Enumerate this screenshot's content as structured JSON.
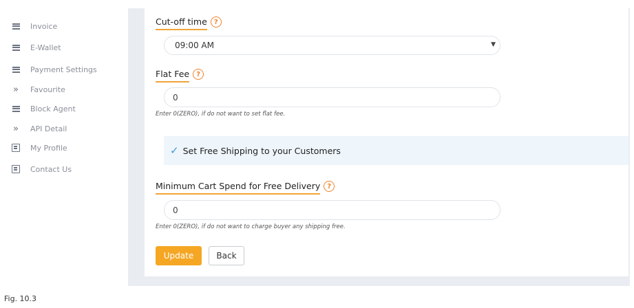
{
  "sidebar": {
    "items": [
      {
        "label": "Invoice",
        "icon": "list-icon"
      },
      {
        "label": "E-Wallet",
        "icon": "list-icon"
      },
      {
        "label": "Payment Settings",
        "icon": "list-icon"
      },
      {
        "label": "Favourite",
        "icon": "double-chevron-icon"
      },
      {
        "label": "Block Agent",
        "icon": "list-icon"
      },
      {
        "label": "API Detail",
        "icon": "double-chevron-icon"
      },
      {
        "label": "My Profile",
        "icon": "form-icon"
      },
      {
        "label": "Contact Us",
        "icon": "form-icon"
      }
    ]
  },
  "form": {
    "cutoff": {
      "label": "Cut-off time",
      "help": "?",
      "value": "09:00 AM"
    },
    "flat_fee": {
      "label": "Flat Fee",
      "help": "?",
      "value": "0",
      "hint": "Enter 0(ZERO), if do not want to set flat fee."
    },
    "free_shipping": {
      "label": "Set Free Shipping to your Customers",
      "checked": true
    },
    "min_cart": {
      "label": "Minimum Cart Spend for Free Delivery",
      "help": "?",
      "value": "0",
      "hint": "Enter 0(ZERO), if do not want to charge buyer any shipping free."
    },
    "update_label": "Update",
    "back_label": "Back"
  },
  "caption": "Fig. 10.3",
  "colors": {
    "accent": "#f5a623",
    "help": "#f0842c",
    "check": "#3a9ad9",
    "panel": "#eef5fb"
  }
}
